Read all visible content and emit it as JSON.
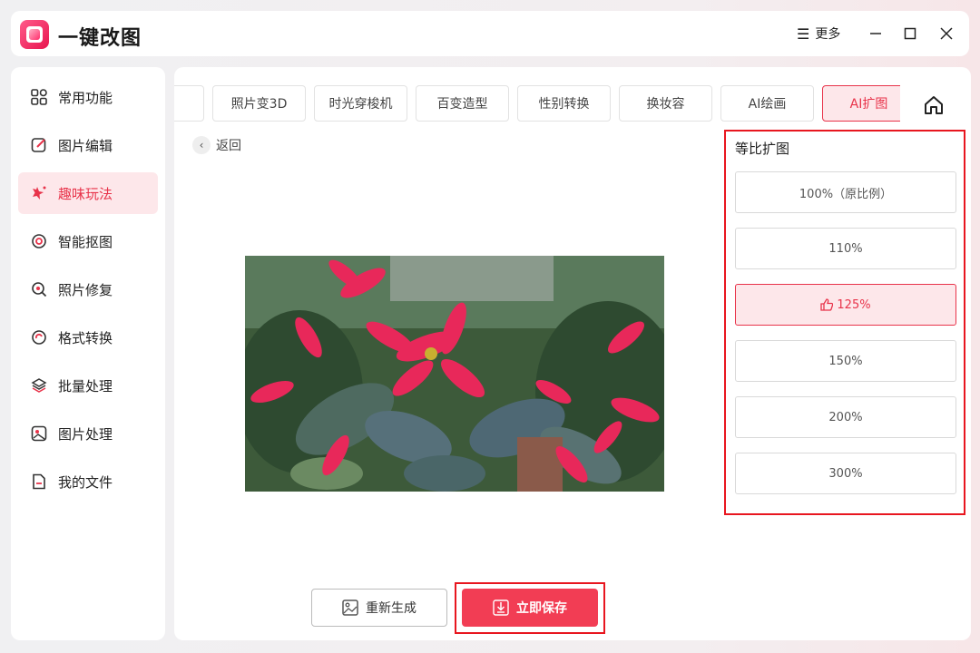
{
  "app": {
    "title": "一键改图",
    "more_label": "更多"
  },
  "sidebar": {
    "items": [
      {
        "label": "常用功能",
        "icon": "grid-icon"
      },
      {
        "label": "图片编辑",
        "icon": "edit-icon"
      },
      {
        "label": "趣味玩法",
        "icon": "sparkle-icon",
        "active": true
      },
      {
        "label": "智能抠图",
        "icon": "target-icon"
      },
      {
        "label": "照片修复",
        "icon": "repair-icon"
      },
      {
        "label": "格式转换",
        "icon": "convert-icon"
      },
      {
        "label": "批量处理",
        "icon": "layers-icon"
      },
      {
        "label": "图片处理",
        "icon": "image-icon"
      },
      {
        "label": "我的文件",
        "icon": "file-icon"
      }
    ]
  },
  "tabs": [
    "照片变3D",
    "时光穿梭机",
    "百变造型",
    "性别转换",
    "换妆容",
    "AI绘画",
    "AI扩图"
  ],
  "active_tab": "AI扩图",
  "back_label": "返回",
  "panel": {
    "title": "等比扩图",
    "options": [
      "100%（原比例）",
      "110%",
      "125%",
      "150%",
      "200%",
      "300%"
    ],
    "selected": "125%"
  },
  "actions": {
    "regenerate": "重新生成",
    "save": "立即保存"
  },
  "colors": {
    "accent": "#f23d54",
    "accent_light": "#fde7ea",
    "highlight_border": "#e8161f"
  }
}
